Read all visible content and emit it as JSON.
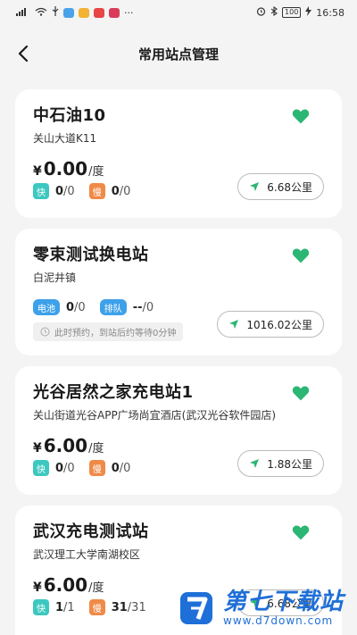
{
  "statusbar": {
    "time": "16:58",
    "battery": "100"
  },
  "header": {
    "title": "常用站点管理"
  },
  "colors": {
    "accent_green": "#2bb673",
    "fast_tag": "#3cc8c0",
    "slow_tag": "#ef8a47",
    "battery_tag": "#3da1ea",
    "watermark_blue": "#1e6fd8"
  },
  "stations": [
    {
      "name": "中石油10",
      "address": "关山大道K11",
      "currency": "¥",
      "price": "0.00",
      "unit": "/度",
      "fast_label": "快",
      "fast_used": "0",
      "fast_total": "/0",
      "slow_label": "慢",
      "slow_used": "0",
      "slow_total": "/0",
      "distance": "6.68公里"
    },
    {
      "name": "零束测试换电站",
      "address": "白泥井镇",
      "battery_label": "电池",
      "battery_used": "0",
      "battery_total": "/0",
      "queue_label": "排队",
      "queue_used": "--",
      "queue_total": "/0",
      "notice": "此时预约，到站后约等待0分钟",
      "distance": "1016.02公里"
    },
    {
      "name": "光谷居然之家充电站1",
      "address": "关山街道光谷APP广场尚宜酒店(武汉光谷软件园店)",
      "currency": "¥",
      "price": "6.00",
      "unit": "/度",
      "fast_label": "快",
      "fast_used": "0",
      "fast_total": "/0",
      "slow_label": "慢",
      "slow_used": "0",
      "slow_total": "/0",
      "distance": "1.88公里"
    },
    {
      "name": "武汉充电测试站",
      "address": "武汉理工大学南湖校区",
      "currency": "¥",
      "price": "6.00",
      "unit": "/度",
      "fast_label": "快",
      "fast_used": "1",
      "fast_total": "/1",
      "slow_label": "慢",
      "slow_used": "31",
      "slow_total": "/31",
      "distance": "6.68公里"
    }
  ],
  "watermark": {
    "title": "第七下载站",
    "url": "www.d7down.com"
  }
}
